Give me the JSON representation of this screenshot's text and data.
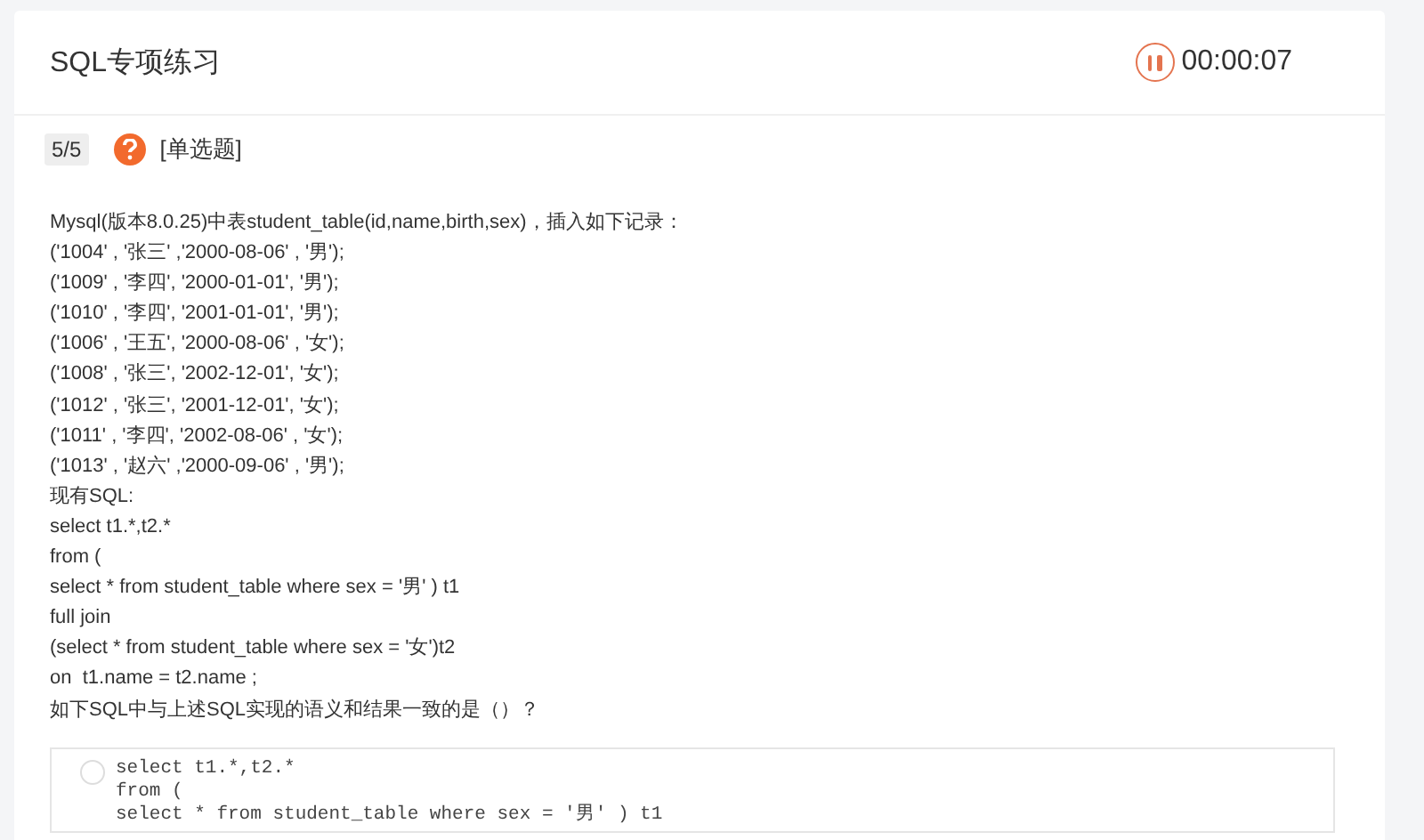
{
  "header": {
    "title": "SQL专项练习",
    "timer": "00:00:07",
    "paused": false
  },
  "question": {
    "progress": "5/5",
    "type": "[单选题]",
    "lines": [
      "Mysql(版本8.0.25)中表student_table(id,name,birth,sex)，插入如下记录：",
      "('1004' , '张三' ,'2000-08-06' , '男');",
      "('1009' , '李四', '2000-01-01', '男');",
      "('1010' , '李四', '2001-01-01', '男');",
      "('1006' , '王五', '2000-08-06' , '女');",
      "('1008' , '张三', '2002-12-01', '女');",
      "('1012' , '张三', '2001-12-01', '女');",
      "('1011' , '李四', '2002-08-06' , '女');",
      "('1013' , '赵六' ,'2000-09-06' , '男');",
      "现有SQL:",
      "select t1.*,t2.*",
      "from (",
      "select * from student_table where sex = '男' ) t1",
      "full join",
      "(select * from student_table where sex = '女')t2",
      "on  t1.name = t2.name ;",
      "如下SQL中与上述SQL实现的语义和结果一致的是（）？"
    ]
  },
  "options": [
    {
      "selected": false,
      "lines": [
        "select t1.*,t2.*",
        "from (",
        "select * from student_table where sex = '男' ) t1"
      ]
    }
  ]
}
